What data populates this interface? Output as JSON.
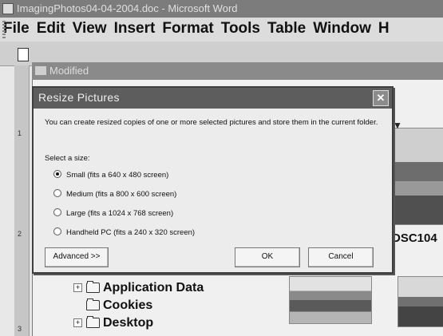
{
  "word": {
    "title": "ImagingPhotos04-04-2004.doc - Microsoft Word",
    "menus": [
      "File",
      "Edit",
      "View",
      "Insert",
      "Format",
      "Tools",
      "Table",
      "Window",
      "H"
    ]
  },
  "ruler": {
    "marks": [
      "1",
      "2",
      "3"
    ]
  },
  "explorer": {
    "title": "Modified",
    "thumb_label": "DSC104",
    "dropdown_glyph": "▼",
    "tree": [
      {
        "label": "Application Data",
        "expander": "+"
      },
      {
        "label": "Cookies",
        "expander": ""
      },
      {
        "label": "Desktop",
        "expander": "+"
      }
    ]
  },
  "dialog": {
    "title": "Resize Pictures",
    "close_glyph": "✕",
    "description": "You can create resized copies of one or more selected pictures and store them in the current folder.",
    "select_label": "Select a size:",
    "options": [
      {
        "label": "Small (fits a 640 x 480 screen)",
        "selected": true
      },
      {
        "label": "Medium (fits a 800 x 600 screen)",
        "selected": false
      },
      {
        "label": "Large (fits a 1024 x 768 screen)",
        "selected": false
      },
      {
        "label": "Handheld PC (fits a 240 x 320 screen)",
        "selected": false
      }
    ],
    "advanced_label": "Advanced >>",
    "ok_label": "OK",
    "cancel_label": "Cancel"
  }
}
